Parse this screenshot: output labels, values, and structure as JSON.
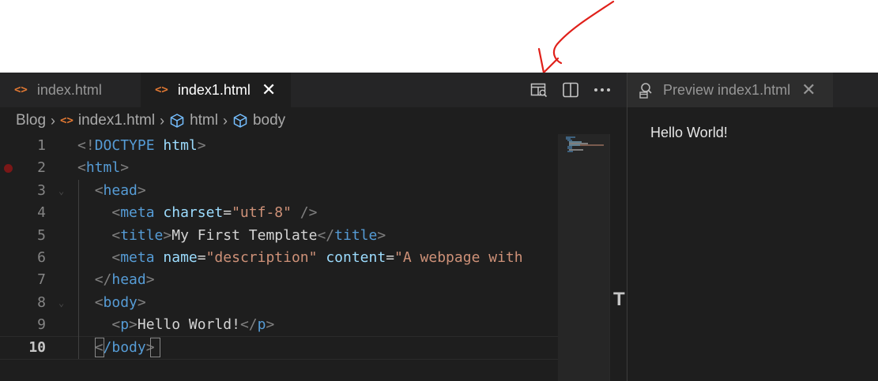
{
  "tabs": [
    {
      "label": "index.html",
      "icon": "html-file-icon",
      "active": false
    },
    {
      "label": "index1.html",
      "icon": "html-file-icon",
      "active": true
    }
  ],
  "tab_icon_glyph": "<>",
  "close_glyph": "✕",
  "breadcrumbs": {
    "root": "Blog",
    "file": "index1.html",
    "symbol1": "html",
    "symbol2": "body"
  },
  "editor": {
    "current_line": 10,
    "breakpoint_line": 2,
    "lines": [
      {
        "n": "1",
        "segments": [
          [
            "punc",
            "<!"
          ],
          [
            "tag",
            "DOCTYPE "
          ],
          [
            "attr",
            "html"
          ],
          [
            "punc",
            ">"
          ]
        ]
      },
      {
        "n": "2",
        "segments": [
          [
            "punc",
            "<"
          ],
          [
            "tag",
            "html"
          ],
          [
            "punc",
            ">"
          ]
        ]
      },
      {
        "n": "3",
        "segments": [
          [
            "text",
            "  "
          ],
          [
            "punc",
            "<"
          ],
          [
            "tag",
            "head"
          ],
          [
            "punc",
            ">"
          ]
        ]
      },
      {
        "n": "4",
        "segments": [
          [
            "text",
            "    "
          ],
          [
            "punc",
            "<"
          ],
          [
            "tag",
            "meta "
          ],
          [
            "attr",
            "charset"
          ],
          [
            "text",
            "="
          ],
          [
            "str",
            "\"utf-8\""
          ],
          [
            "text",
            " "
          ],
          [
            "punc",
            "/>"
          ]
        ]
      },
      {
        "n": "5",
        "segments": [
          [
            "text",
            "    "
          ],
          [
            "punc",
            "<"
          ],
          [
            "tag",
            "title"
          ],
          [
            "punc",
            ">"
          ],
          [
            "text",
            "My First Template"
          ],
          [
            "punc",
            "</"
          ],
          [
            "tag",
            "title"
          ],
          [
            "punc",
            ">"
          ]
        ]
      },
      {
        "n": "6",
        "segments": [
          [
            "text",
            "    "
          ],
          [
            "punc",
            "<"
          ],
          [
            "tag",
            "meta "
          ],
          [
            "attr",
            "name"
          ],
          [
            "text",
            "="
          ],
          [
            "str",
            "\"description\""
          ],
          [
            "text",
            " "
          ],
          [
            "attr",
            "content"
          ],
          [
            "text",
            "="
          ],
          [
            "str",
            "\"A webpage with"
          ]
        ]
      },
      {
        "n": "7",
        "segments": [
          [
            "text",
            "  "
          ],
          [
            "punc",
            "</"
          ],
          [
            "tag",
            "head"
          ],
          [
            "punc",
            ">"
          ]
        ]
      },
      {
        "n": "8",
        "segments": [
          [
            "text",
            "  "
          ],
          [
            "punc",
            "<"
          ],
          [
            "tag",
            "body"
          ],
          [
            "punc",
            ">"
          ]
        ]
      },
      {
        "n": "9",
        "segments": [
          [
            "text",
            "    "
          ],
          [
            "punc",
            "<"
          ],
          [
            "tag",
            "p"
          ],
          [
            "punc",
            ">"
          ],
          [
            "text",
            "Hello World!"
          ],
          [
            "punc",
            "</"
          ],
          [
            "tag",
            "p"
          ],
          [
            "punc",
            ">"
          ]
        ]
      },
      {
        "n": "10",
        "segments": [
          [
            "text",
            "  "
          ],
          [
            "punc",
            "<"
          ],
          [
            "tag",
            "/body"
          ],
          [
            "punc",
            ">"
          ]
        ]
      }
    ]
  },
  "preview": {
    "tab_label": "Preview index1.html",
    "content": "Hello World!"
  },
  "overview_ruler_glyph": "T",
  "colors": {
    "annotation_red": "#e0201a",
    "html_icon_orange": "#e37933",
    "symbol_blue": "#75beff",
    "breakpoint": "#7a1717"
  }
}
